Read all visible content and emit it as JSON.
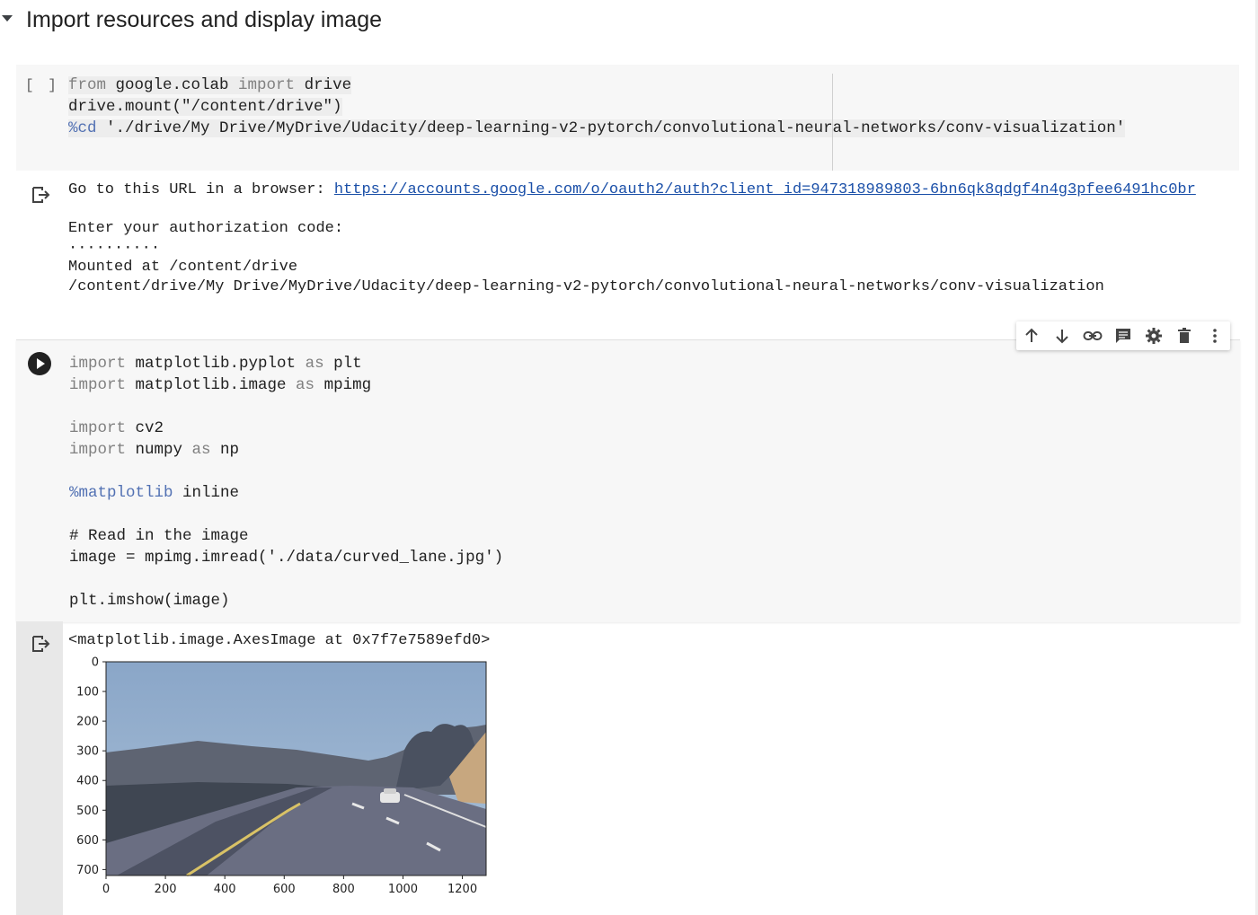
{
  "section": {
    "title": "Import resources and display image"
  },
  "cell1": {
    "bracket": "[ ]",
    "lines": [
      [
        {
          "t": "from",
          "c": "kw"
        },
        {
          "t": " google.colab ",
          "c": ""
        },
        {
          "t": "import",
          "c": "kw"
        },
        {
          "t": " drive",
          "c": ""
        }
      ],
      [
        {
          "t": "drive.mount(\"/content/drive\")",
          "c": ""
        }
      ],
      [
        {
          "t": "%cd",
          "c": "mg"
        },
        {
          "t": " './drive/My Drive/MyDrive/Udacity/deep-learning-v2-pytorch/convolutional-neural-networks/conv-visualization'",
          "c": ""
        }
      ]
    ]
  },
  "output1": {
    "url_prefix": "Go to this URL in a browser: ",
    "url": "https://accounts.google.com/o/oauth2/auth?client_id=947318989803-6bn6qk8qdgf4n4g3pfee6491hc0br",
    "enter_code": "Enter your authorization code:",
    "dots": "··········",
    "mounted": "Mounted at /content/drive",
    "cwd": "/content/drive/My Drive/MyDrive/Udacity/deep-learning-v2-pytorch/convolutional-neural-networks/conv-visualization"
  },
  "toolbar": {
    "icons": [
      "arrow-up-icon",
      "arrow-down-icon",
      "link-icon",
      "comment-icon",
      "gear-icon",
      "trash-icon",
      "more-vert-icon"
    ]
  },
  "cell2": {
    "lines": [
      [
        {
          "t": "import",
          "c": "kw"
        },
        {
          "t": " matplotlib.pyplot ",
          "c": ""
        },
        {
          "t": "as",
          "c": "kw"
        },
        {
          "t": " plt",
          "c": ""
        }
      ],
      [
        {
          "t": "import",
          "c": "kw"
        },
        {
          "t": " matplotlib.image ",
          "c": ""
        },
        {
          "t": "as",
          "c": "kw"
        },
        {
          "t": " mpimg",
          "c": ""
        }
      ],
      [],
      [
        {
          "t": "import",
          "c": "kw"
        },
        {
          "t": " cv2",
          "c": ""
        }
      ],
      [
        {
          "t": "import",
          "c": "kw"
        },
        {
          "t": " numpy ",
          "c": ""
        },
        {
          "t": "as",
          "c": "kw"
        },
        {
          "t": " np",
          "c": ""
        }
      ],
      [],
      [
        {
          "t": "%matplotlib",
          "c": "mg"
        },
        {
          "t": " inline",
          "c": ""
        }
      ],
      [],
      [
        {
          "t": "# Read in the image",
          "c": "cmt"
        }
      ],
      [
        {
          "t": "image = mpimg.imread('./data/curved_lane.jpg')",
          "c": ""
        }
      ],
      [],
      [
        {
          "t": "plt.imshow(image)",
          "c": ""
        }
      ]
    ]
  },
  "output2": {
    "repr": "<matplotlib.image.AxesImage at 0x7f7e7589efd0>"
  },
  "chart_data": {
    "type": "image",
    "x_ticks": [
      "0",
      "200",
      "400",
      "600",
      "800",
      "1000",
      "1200"
    ],
    "y_ticks": [
      "0",
      "100",
      "200",
      "300",
      "400",
      "500",
      "600",
      "700"
    ],
    "xlim": [
      0,
      1280
    ],
    "ylim": [
      720,
      0
    ]
  }
}
